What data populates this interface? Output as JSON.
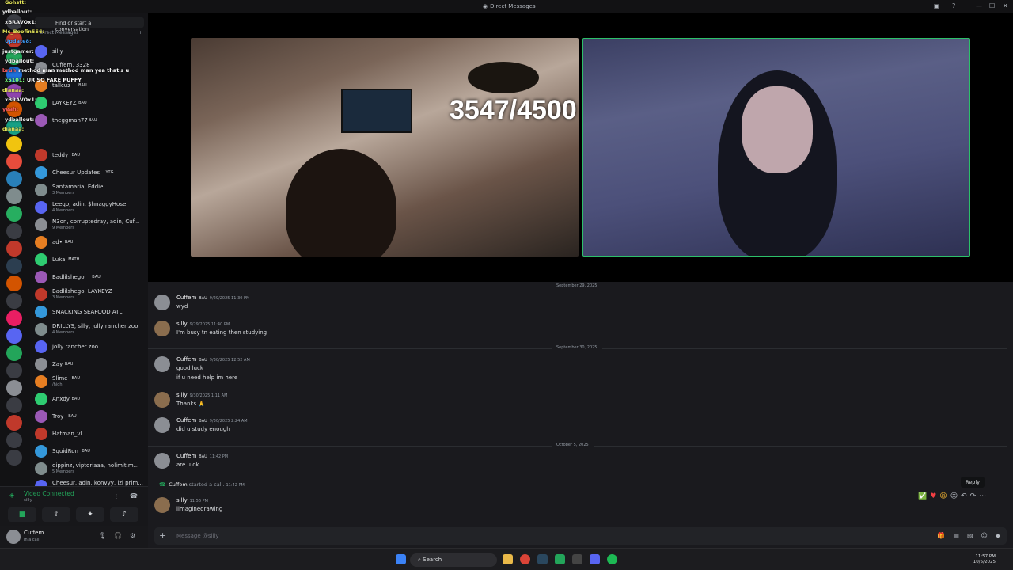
{
  "window": {
    "title": "Direct Messages"
  },
  "dm_panel": {
    "search_placeholder": "Find or start a conversation",
    "header": "Direct Messages",
    "items": [
      {
        "name": "silly",
        "sub": ""
      },
      {
        "name": "Cuffem, 3328",
        "sub": "3 Members"
      },
      {
        "name": "tallcuz",
        "tag": "BAU",
        "sub": ""
      },
      {
        "name": "LAYKEYZ",
        "tag": "BAU",
        "sub": ""
      },
      {
        "name": "theggman77",
        "tag": "BAU",
        "sub": ""
      },
      {
        "name": "teddy",
        "tag": "BAU",
        "sub": ""
      },
      {
        "name": "Cheesur Updates",
        "tag": "YTG",
        "sub": ""
      },
      {
        "name": "Santamaria, Eddie",
        "sub": "3 Members"
      },
      {
        "name": "Leeqo, adin, $hnaggyHose",
        "sub": "4 Members"
      },
      {
        "name": "N3on, corruptedray, adin, Cuf...",
        "sub": "9 Members"
      },
      {
        "name": "ad•",
        "tag": "BAU",
        "sub": ""
      },
      {
        "name": "Luka",
        "tag": "MATH",
        "sub": ""
      },
      {
        "name": "Badlilshego",
        "tag": "BAU",
        "sub": ""
      },
      {
        "name": "Badlilshego, LAYKEYZ",
        "sub": "3 Members"
      },
      {
        "name": "SMACKING SEAFOOD ATL",
        "sub": ""
      },
      {
        "name": "DRILLYS, silly, jolly rancher zoo",
        "sub": "4 Members"
      },
      {
        "name": "jolly rancher zoo",
        "sub": ""
      },
      {
        "name": "Zay",
        "tag": "BAU",
        "sub": ""
      },
      {
        "name": "Slime",
        "tag": "BAU",
        "sub": "/high"
      },
      {
        "name": "Anxdy",
        "tag": "BAU",
        "sub": ""
      },
      {
        "name": "Troy",
        "tag": "BAU",
        "sub": ""
      },
      {
        "name": "Hatman_vl",
        "sub": ""
      },
      {
        "name": "SquidRon",
        "tag": "BAU",
        "sub": ""
      },
      {
        "name": "dippinz, viptoriaaa, nolimit.m...",
        "sub": "5 Members"
      },
      {
        "name": "Cheesur, adin, konvyy, izi prim...",
        "sub": "6 Members"
      }
    ]
  },
  "stream_chat": [
    {
      "user": "Gohstt:",
      "color": "#e6e65a"
    },
    {
      "user": "ydballout:",
      "color": "#f0f0f0"
    },
    {
      "user": "xBRAVOx1:",
      "color": "#f0f0f0"
    },
    {
      "user": "Mc_Boofin556:",
      "color": "#e6e65a"
    },
    {
      "user": "Update8:",
      "color": "#3fa0ff"
    },
    {
      "user": "justgamer:",
      "color": "#f0f0f0"
    },
    {
      "user": "ydballout:",
      "color": "#f0f0f0"
    },
    {
      "user": "bruh",
      "msg": "method man method man yea that's u",
      "color": "#ff6060"
    },
    {
      "user": "x5101:",
      "msg": "UR SO FAKE PUFFY",
      "color": "#7cff7c"
    },
    {
      "user": "dianaa:",
      "color": "#e6e65a"
    },
    {
      "user": "xBRAVOx1:",
      "color": "#f0f0f0"
    },
    {
      "user": "yeah:",
      "color": "#ff6060"
    },
    {
      "user": "ydballout:",
      "color": "#f0f0f0"
    },
    {
      "user": "dianaa:",
      "color": "#e6e65a"
    }
  ],
  "voice": {
    "status": "Video Connected",
    "channel": "silly"
  },
  "user_panel": {
    "name": "Cuffem",
    "status": "In a call"
  },
  "stream_overlay": {
    "counter": "3547/4500"
  },
  "messages": {
    "date1": "September 29, 2025",
    "date2": "September 30, 2025",
    "date3": "October 5, 2025",
    "list": [
      {
        "author": "Cuffem",
        "tag": "BAU",
        "time": "9/29/2025 11:30 PM",
        "lines": [
          "wyd"
        ]
      },
      {
        "author": "silly",
        "time": "9/29/2025 11:40 PM",
        "lines": [
          "I'm busy tn eating then studying"
        ]
      },
      {
        "author": "Cuffem",
        "tag": "BAU",
        "time": "9/30/2025 12:52 AM",
        "lines": [
          "good luck",
          "if u need help im here"
        ]
      },
      {
        "author": "silly",
        "time": "9/30/2025 1:11 AM",
        "lines": [
          "Thanks 🙏"
        ]
      },
      {
        "author": "Cuffem",
        "tag": "BAU",
        "time": "9/30/2025 2:24 AM",
        "lines": [
          "did u study enough"
        ]
      },
      {
        "author": "Cuffem",
        "tag": "BAU",
        "time": "11:42 PM",
        "lines": [
          "are u ok"
        ]
      },
      {
        "author": "silly",
        "time": "11:56 PM",
        "lines": [
          "iimaginedrawing"
        ]
      }
    ],
    "call": {
      "author": "Cuffem",
      "text": "started a call.",
      "time": "11:42 PM"
    }
  },
  "hover": {
    "tooltip": "Reply"
  },
  "composer": {
    "placeholder": "Message @silly"
  },
  "taskbar": {
    "search": "Search",
    "time": "11:57 PM",
    "date": "10/5/2025"
  },
  "colors": {
    "accent": "#5865f2",
    "online": "#23a55a",
    "new_line": "#f23f43"
  }
}
